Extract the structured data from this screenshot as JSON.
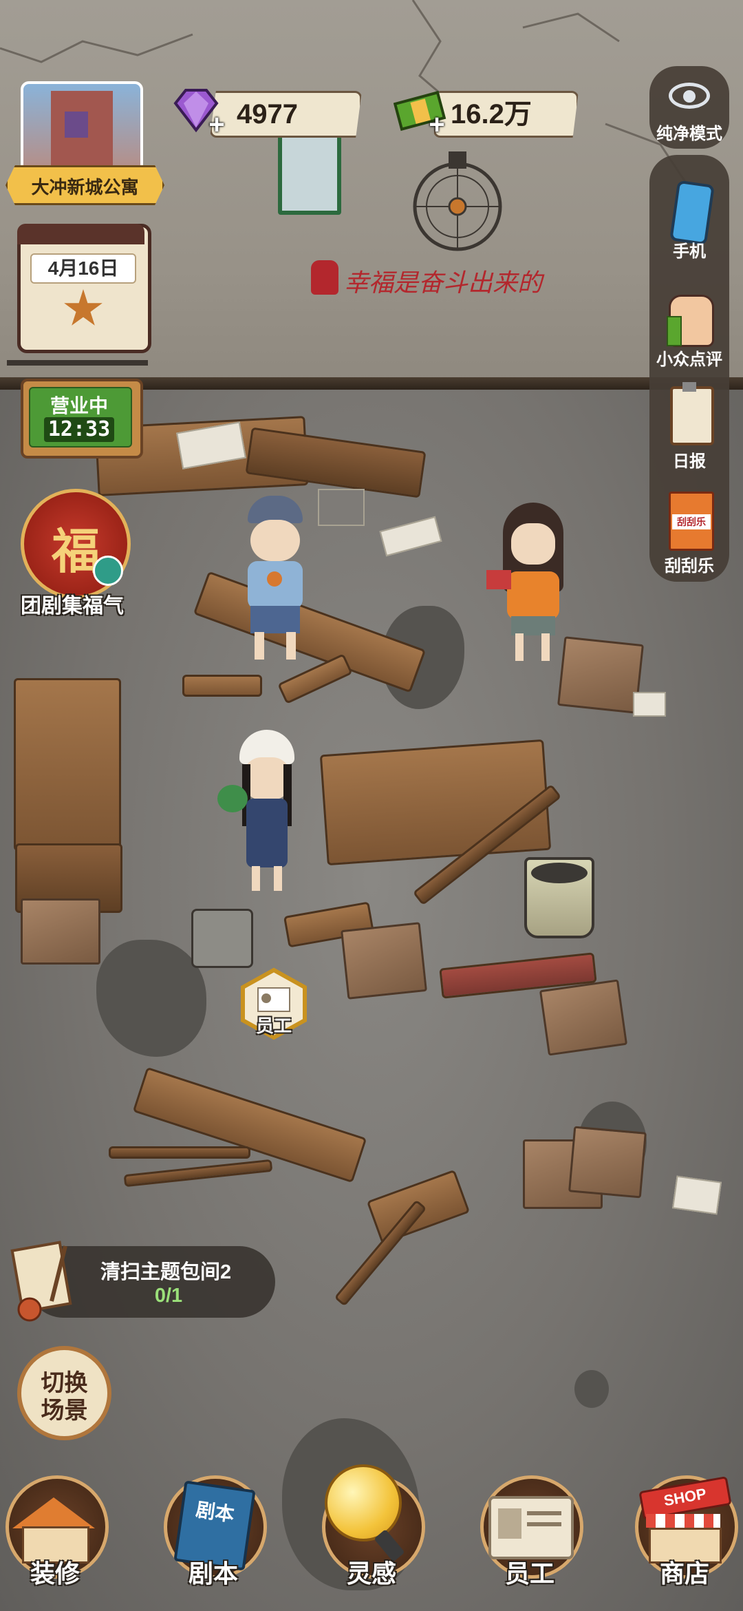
{
  "hud": {
    "location_name": "大冲新城公寓",
    "gems": "4977",
    "money": "16.2万",
    "plus_symbol": "+",
    "date": "4月16日",
    "status": "营业中",
    "time": "12:33",
    "wall_slogan": "幸福是奋斗出来的"
  },
  "right_menu": {
    "pure_mode": "纯净模式",
    "phone": "手机",
    "reviews": "小众点评",
    "daily": "日报",
    "scratch": "刮刮乐",
    "scratch_card_text": "刮刮乐"
  },
  "left_event": {
    "fu_char": "福",
    "label": "团剧集福气"
  },
  "scene": {
    "staff_badge_label": "员工"
  },
  "quest": {
    "title": "清扫主题包间2",
    "progress": "0/1"
  },
  "switch_scene": {
    "line1": "切换",
    "line2": "场景"
  },
  "bottom_nav": {
    "decorate": "装修",
    "script": "剧本",
    "script_book_title": "剧本",
    "inspiration": "灵感",
    "staff": "员工",
    "shop": "商店",
    "shop_sign": "SHOP"
  },
  "colors": {
    "gem": "#9b59d0",
    "money": "#5aa62e",
    "status_green": "#3f8d2a",
    "slogan_red": "#b3272d",
    "nav_ring": "#d7a86c"
  }
}
